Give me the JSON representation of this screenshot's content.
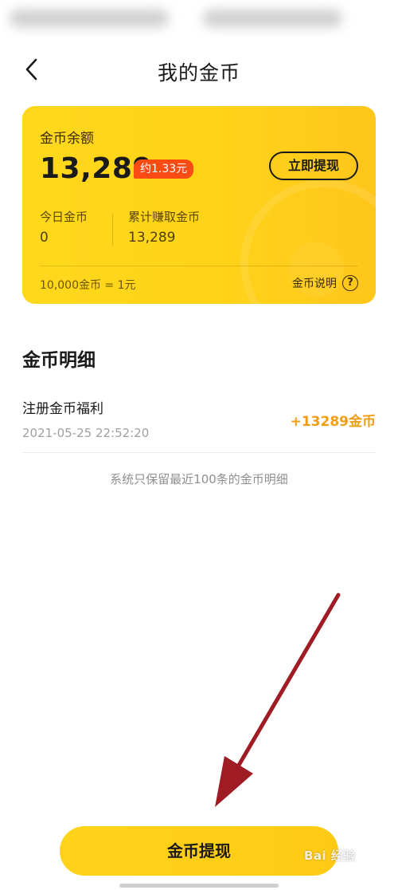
{
  "header": {
    "title": "我的金币"
  },
  "card": {
    "balance_label": "金币余额",
    "balance_value": "13,289",
    "rmb_badge": "约1.33元",
    "withdraw_now_label": "立即提现",
    "today_label": "今日金币",
    "today_value": "0",
    "total_label": "累计赚取金币",
    "total_value": "13,289",
    "rate_text": "10,000金币 = 1元",
    "explain_label": "金币说明",
    "help_glyph": "?"
  },
  "details": {
    "section_title": "金币明细",
    "records": [
      {
        "title": "注册金币福利",
        "time": "2021-05-25 22:52:20",
        "amount": "+13289金币"
      }
    ],
    "footnote": "系统只保留最近100条的金币明细"
  },
  "bottom": {
    "withdraw_label": "金币提现"
  },
  "watermark": {
    "text": "Bai 经验"
  },
  "colors": {
    "card_yellow": "#ffd318",
    "badge_red": "#fb4b14",
    "amount_orange": "#f39c12",
    "arrow": "#a01c24"
  },
  "icons": {
    "back": "chevron-left-icon",
    "help": "question-circle-icon",
    "annotation": "arrow-icon"
  }
}
